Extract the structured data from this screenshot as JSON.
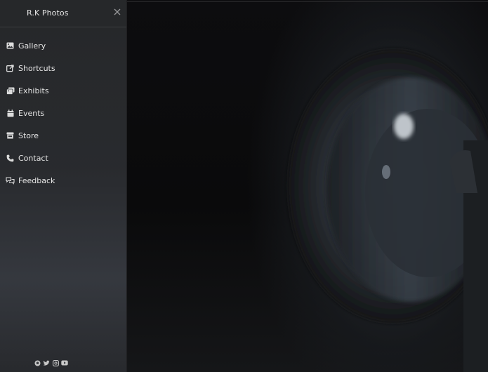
{
  "sidebar": {
    "brand": "R.K Photos",
    "close_icon": "close-icon",
    "items": [
      {
        "label": "Gallery",
        "icon": "image-icon"
      },
      {
        "label": "Shortcuts",
        "icon": "external-link-icon"
      },
      {
        "label": "Exhibits",
        "icon": "images-icon"
      },
      {
        "label": "Events",
        "icon": "calendar-icon"
      },
      {
        "label": "Store",
        "icon": "store-icon"
      },
      {
        "label": "Contact",
        "icon": "phone-icon"
      },
      {
        "label": "Feedback",
        "icon": "chat-icon"
      }
    ],
    "socials": [
      "github-icon",
      "twitter-icon",
      "instagram-icon",
      "youtube-icon"
    ]
  },
  "colors": {
    "text": "#e6e6e6",
    "icon": "#dcdcdc",
    "background": "#0b0b0c"
  }
}
